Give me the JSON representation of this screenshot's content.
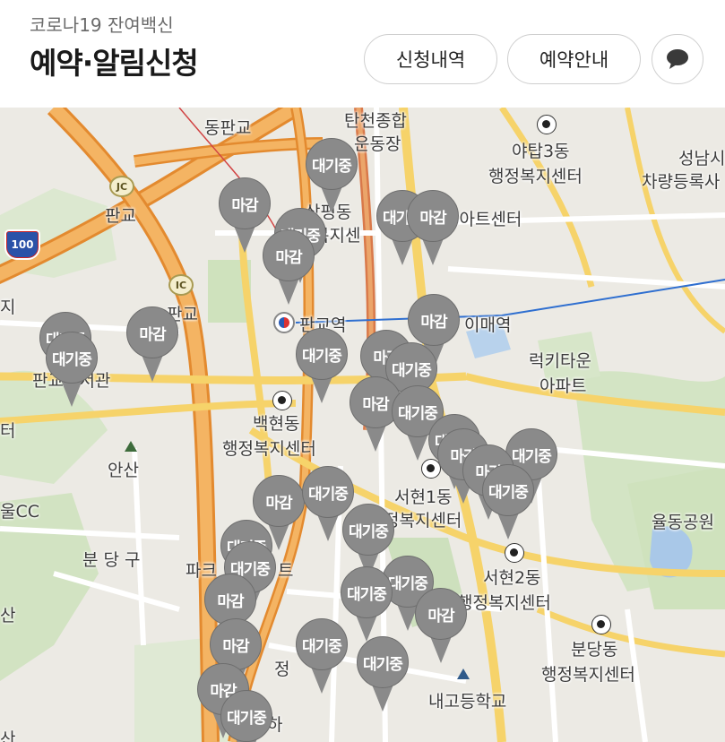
{
  "header": {
    "subtitle": "코로나19 잔여백신",
    "title": "예약·알림신청",
    "history_button": "신청내역",
    "guide_button": "예약안내",
    "chat_icon": "speech-bubble-icon"
  },
  "colors": {
    "pin": "#8a8a8a",
    "highway": "#f1a242",
    "road": "#ffffff",
    "park": "#cfe2bd",
    "water": "#a9c8e8"
  },
  "map": {
    "labels": {
      "dongpangyo": "동판교",
      "tancheon": "탄천종합",
      "undongjang": "운동장",
      "yatap": "야탑3동",
      "yatap_center": "행정복지센터",
      "seongnam": "성남시",
      "vehicle_reg": "차량등록사",
      "pangyo": "판교",
      "samp_dong": "삼평동",
      "samp_center": "복지센",
      "art_center": "남아트센터",
      "pangyo2": "판교",
      "pangyo_station": "판교역",
      "imae_station": "이매역",
      "ji": "지",
      "library": "판교도서관",
      "lucky": "럭키타운",
      "apt": "아파트",
      "baekhyeon": "백현동",
      "baekhyeon_center": "행정복지센터",
      "teo": "터",
      "ansan": "안산",
      "golf": "울CC",
      "seohyeon1": "서현1동",
      "seohyeon1_center": "정복지센터",
      "yuldong": "율동공원",
      "bundang_gu": "분 당 구",
      "park_tower": "파크",
      "park_tower2": "트",
      "seohyeon2": "서현2동",
      "seohyeon2_center": "행정복지센터",
      "san": "산",
      "bundang_dong": "분당동",
      "bundang_center": "행정복지센터",
      "jeong": "정",
      "naego": "내고등학교",
      "bottom_san": "산",
      "ha": "하",
      "jc": "JC",
      "ic": "IC",
      "hw100": "100"
    },
    "pins": [
      {
        "label": "대기중"
      },
      {
        "label": "마감"
      },
      {
        "label": "대기중"
      },
      {
        "label": "마감"
      },
      {
        "label": "대기중"
      },
      {
        "label": "마감"
      },
      {
        "label": "대기중"
      },
      {
        "label": "마감"
      },
      {
        "label": "대기중"
      },
      {
        "label": "마감"
      },
      {
        "label": "대기중"
      },
      {
        "label": "마감"
      },
      {
        "label": "대기중"
      },
      {
        "label": "마감"
      },
      {
        "label": "대기중"
      },
      {
        "label": "대기중"
      },
      {
        "label": "대기중"
      },
      {
        "label": "마감"
      },
      {
        "label": "마감"
      },
      {
        "label": "대기중"
      },
      {
        "label": "마감"
      },
      {
        "label": "대기중"
      },
      {
        "label": "대기중"
      },
      {
        "label": "대기중"
      },
      {
        "label": "대기중"
      },
      {
        "label": "대기중"
      },
      {
        "label": "마감"
      },
      {
        "label": "마감"
      },
      {
        "label": "대기중"
      },
      {
        "label": "마감"
      },
      {
        "label": "대기중"
      },
      {
        "label": "대기중"
      },
      {
        "label": "마감"
      },
      {
        "label": "대기중"
      }
    ]
  }
}
